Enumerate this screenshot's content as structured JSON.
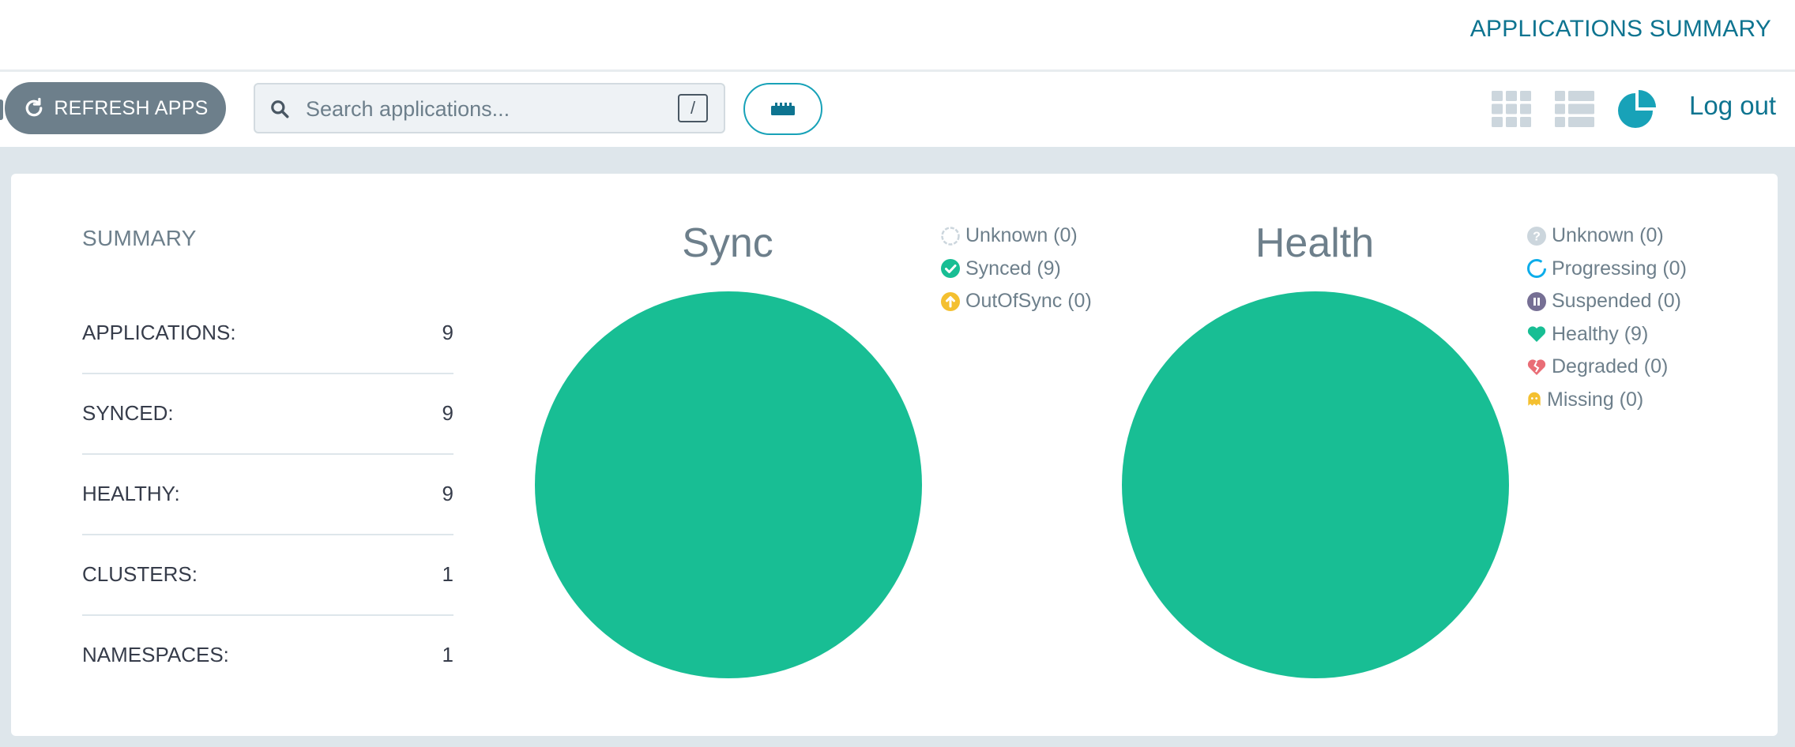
{
  "header": {
    "title": "APPLICATIONS SUMMARY"
  },
  "toolbar": {
    "refresh_label": "REFRESH APPS",
    "search_placeholder": "Search applications...",
    "search_shortcut": "/",
    "logout_label": "Log out",
    "icons": [
      "refresh-icon",
      "search-icon",
      "filter-ruler-icon",
      "tiles-view-icon",
      "list-view-icon",
      "summary-pie-icon"
    ]
  },
  "summary": {
    "title": "SUMMARY",
    "rows": [
      {
        "label": "APPLICATIONS:",
        "value": "9"
      },
      {
        "label": "SYNCED:",
        "value": "9"
      },
      {
        "label": "HEALTHY:",
        "value": "9"
      },
      {
        "label": "CLUSTERS:",
        "value": "1"
      },
      {
        "label": "NAMESPACES:",
        "value": "1"
      }
    ]
  },
  "colors": {
    "accent": "#18a2b8",
    "synced": "#18be94",
    "healthy": "#18be94",
    "outofsync": "#f4c030",
    "degraded": "#e96d76",
    "suspended": "#766f94",
    "unknown": "#ccd6dd"
  },
  "chart_data": [
    {
      "type": "pie",
      "title": "Sync",
      "categories": [
        "Unknown",
        "Synced",
        "OutOfSync"
      ],
      "values": [
        0,
        9,
        0
      ],
      "legend": [
        {
          "label": "Unknown (0)",
          "icon": "unknown-circle-icon",
          "color": "#ccd6dd"
        },
        {
          "label": "Synced (9)",
          "icon": "check-circle-icon",
          "color": "#18be94"
        },
        {
          "label": "OutOfSync (0)",
          "icon": "arrow-up-circle-icon",
          "color": "#f4c030"
        }
      ],
      "legend_position": "top-right"
    },
    {
      "type": "pie",
      "title": "Health",
      "categories": [
        "Unknown",
        "Progressing",
        "Suspended",
        "Healthy",
        "Degraded",
        "Missing"
      ],
      "values": [
        0,
        0,
        0,
        9,
        0,
        0
      ],
      "legend": [
        {
          "label": "Unknown (0)",
          "icon": "question-circle-icon",
          "color": "#ccd6dd"
        },
        {
          "label": "Progressing (0)",
          "icon": "progress-ring-icon",
          "color": "#0dadea"
        },
        {
          "label": "Suspended (0)",
          "icon": "pause-circle-icon",
          "color": "#766f94"
        },
        {
          "label": "Healthy (9)",
          "icon": "heart-icon",
          "color": "#18be94"
        },
        {
          "label": "Degraded (0)",
          "icon": "broken-heart-icon",
          "color": "#e96d76"
        },
        {
          "label": "Missing (0)",
          "icon": "ghost-icon",
          "color": "#f4c030"
        }
      ],
      "legend_position": "top-right"
    }
  ]
}
